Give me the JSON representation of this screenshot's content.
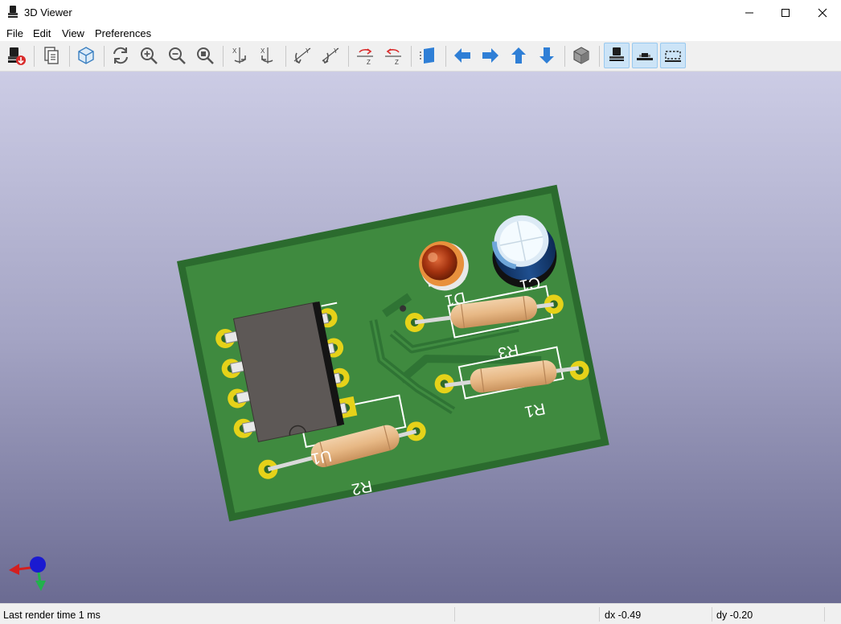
{
  "window": {
    "title": "3D Viewer"
  },
  "menu": {
    "file": "File",
    "edit": "Edit",
    "view": "View",
    "preferences": "Preferences"
  },
  "toolbar_icons": [
    "render-export-icon",
    "copy-clipboard-icon",
    "raytrace-cube-icon",
    "reload-icon",
    "zoom-in-icon",
    "zoom-out-icon",
    "zoom-fit-icon",
    "rotate-x-cw-icon",
    "rotate-x-ccw-icon",
    "rotate-y-cw-icon",
    "rotate-y-ccw-icon",
    "rotate-z-cw-icon",
    "rotate-z-ccw-icon",
    "flip-board-icon",
    "pan-left-icon",
    "pan-right-icon",
    "pan-up-icon",
    "pan-down-icon",
    "orthographic-icon",
    "show-tht-icon",
    "show-smd-icon",
    "show-virtual-icon"
  ],
  "board": {
    "labels": {
      "u1": "U1",
      "d1": "D1",
      "c1": "C1",
      "r1": "R1",
      "r2": "R2",
      "r3": "R3"
    },
    "colors": {
      "soldermask": "#3f8a3f",
      "board_edge": "#2b6b2e",
      "pad": "#e6d219",
      "ic_body": "#5d5856"
    }
  },
  "status": {
    "render_time": "Last render time 1 ms",
    "dx": "dx -0.49",
    "dy": "dy -0.20"
  }
}
